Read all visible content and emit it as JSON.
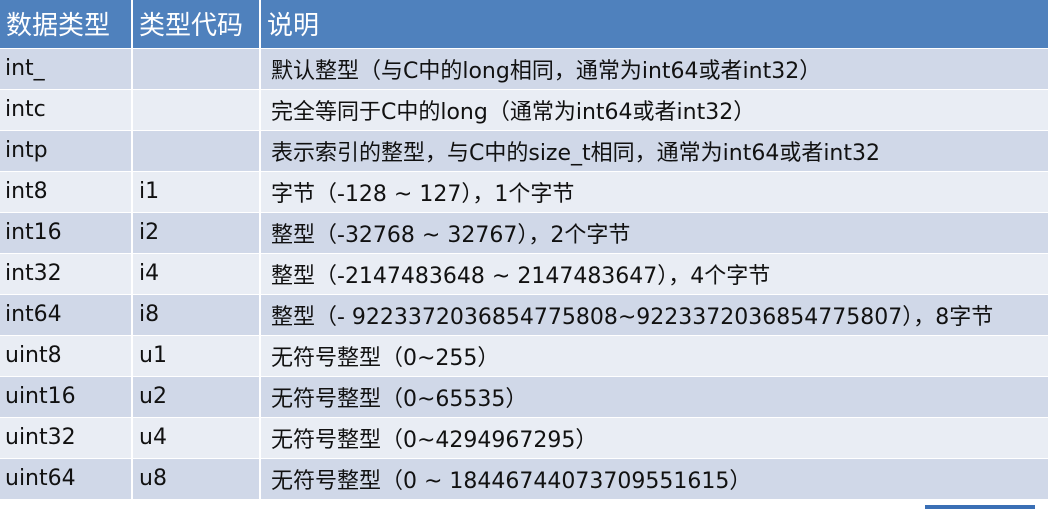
{
  "table": {
    "headers": [
      "数据类型",
      "类型代码",
      "说明"
    ],
    "rows": [
      [
        "int_",
        "",
        "默认整型（与C中的long相同，通常为int64或者int32）"
      ],
      [
        "intc",
        "",
        "完全等同于C中的long（通常为int64或者int32）"
      ],
      [
        "intp",
        "",
        "表示索引的整型，与C中的size_t相同，通常为int64或者int32"
      ],
      [
        "int8",
        "i1",
        "字节（-128 ~ 127），1个字节"
      ],
      [
        "int16",
        "i2",
        "整型（-32768 ~ 32767），2个字节"
      ],
      [
        "int32",
        "i4",
        "整型（-2147483648 ~ 2147483647），4个字节"
      ],
      [
        "int64",
        "i8",
        "整型（- 9223372036854775808~9223372036854775807），8字节"
      ],
      [
        "uint8",
        "u1",
        "无符号整型（0~255）"
      ],
      [
        "uint16",
        "u2",
        "无符号整型（0~65535）"
      ],
      [
        "uint32",
        "u4",
        "无符号整型（0~4294967295）"
      ],
      [
        "uint64",
        "u8",
        "无符号整型（0 ~ 18446744073709551615）"
      ]
    ]
  },
  "colors": {
    "header_bg": "#4f81bd",
    "row_odd_bg": "#d0d8e8",
    "row_even_bg": "#e9edf4",
    "footer_bar": "#3a6fb5"
  }
}
